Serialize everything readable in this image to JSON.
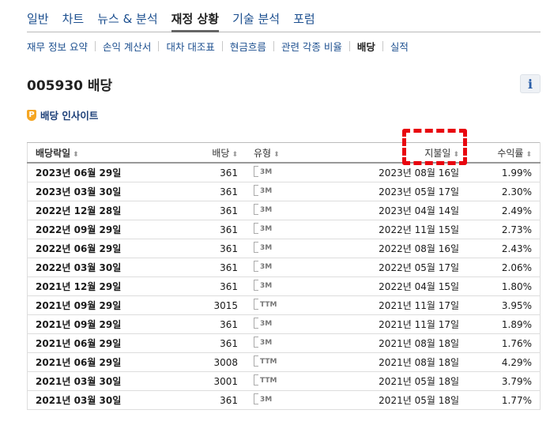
{
  "topnav": {
    "tabs": [
      {
        "label": "일반",
        "active": false
      },
      {
        "label": "차트",
        "active": false
      },
      {
        "label": "뉴스 & 분석",
        "active": false
      },
      {
        "label": "재정 상황",
        "active": true
      },
      {
        "label": "기술 분석",
        "active": false
      },
      {
        "label": "포럼",
        "active": false
      }
    ]
  },
  "subnav": {
    "items": [
      {
        "label": "재무 정보 요약",
        "active": false
      },
      {
        "label": "손익 계산서",
        "active": false
      },
      {
        "label": "대차 대조표",
        "active": false
      },
      {
        "label": "현금흐름",
        "active": false
      },
      {
        "label": "관련 각종 비율",
        "active": false
      },
      {
        "label": "배당",
        "active": true
      },
      {
        "label": "실적",
        "active": false
      }
    ]
  },
  "page": {
    "title": "005930 배당",
    "info_icon": "i"
  },
  "insight": {
    "badge": "P",
    "label": "배당 인사이트"
  },
  "table": {
    "headers": {
      "ex_date": "배당락일",
      "dividend": "배당",
      "type": "유형",
      "pay_date": "지불일",
      "yield": "수익률"
    },
    "sort_glyph": "⬍",
    "rows": [
      {
        "ex_date": "2023년 06월 29일",
        "dividend": "361",
        "type": "3M",
        "pay_date": "2023년 08월 16일",
        "yield": "1.99%"
      },
      {
        "ex_date": "2023년 03월 30일",
        "dividend": "361",
        "type": "3M",
        "pay_date": "2023년 05월 17일",
        "yield": "2.30%"
      },
      {
        "ex_date": "2022년 12월 28일",
        "dividend": "361",
        "type": "3M",
        "pay_date": "2023년 04월 14일",
        "yield": "2.49%"
      },
      {
        "ex_date": "2022년 09월 29일",
        "dividend": "361",
        "type": "3M",
        "pay_date": "2022년 11월 15일",
        "yield": "2.73%"
      },
      {
        "ex_date": "2022년 06월 29일",
        "dividend": "361",
        "type": "3M",
        "pay_date": "2022년 08월 16일",
        "yield": "2.43%"
      },
      {
        "ex_date": "2022년 03월 30일",
        "dividend": "361",
        "type": "3M",
        "pay_date": "2022년 05월 17일",
        "yield": "2.06%"
      },
      {
        "ex_date": "2021년 12월 29일",
        "dividend": "361",
        "type": "3M",
        "pay_date": "2022년 04월 15일",
        "yield": "1.80%"
      },
      {
        "ex_date": "2021년 09월 29일",
        "dividend": "3015",
        "type": "TTM",
        "pay_date": "2021년 11월 17일",
        "yield": "3.95%"
      },
      {
        "ex_date": "2021년 09월 29일",
        "dividend": "361",
        "type": "3M",
        "pay_date": "2021년 11월 17일",
        "yield": "1.89%"
      },
      {
        "ex_date": "2021년 06월 29일",
        "dividend": "361",
        "type": "3M",
        "pay_date": "2021년 08월 18일",
        "yield": "1.76%"
      },
      {
        "ex_date": "2021년 06월 29일",
        "dividend": "3008",
        "type": "TTM",
        "pay_date": "2021년 08월 18일",
        "yield": "4.29%"
      },
      {
        "ex_date": "2021년 03월 30일",
        "dividend": "3001",
        "type": "TTM",
        "pay_date": "2021년 05월 18일",
        "yield": "3.79%"
      },
      {
        "ex_date": "2021년 03월 30일",
        "dividend": "361",
        "type": "3M",
        "pay_date": "2021년 05월 18일",
        "yield": "1.77%"
      }
    ]
  },
  "highlight_color": "#e8060f",
  "link_color": "#1c4f8f"
}
